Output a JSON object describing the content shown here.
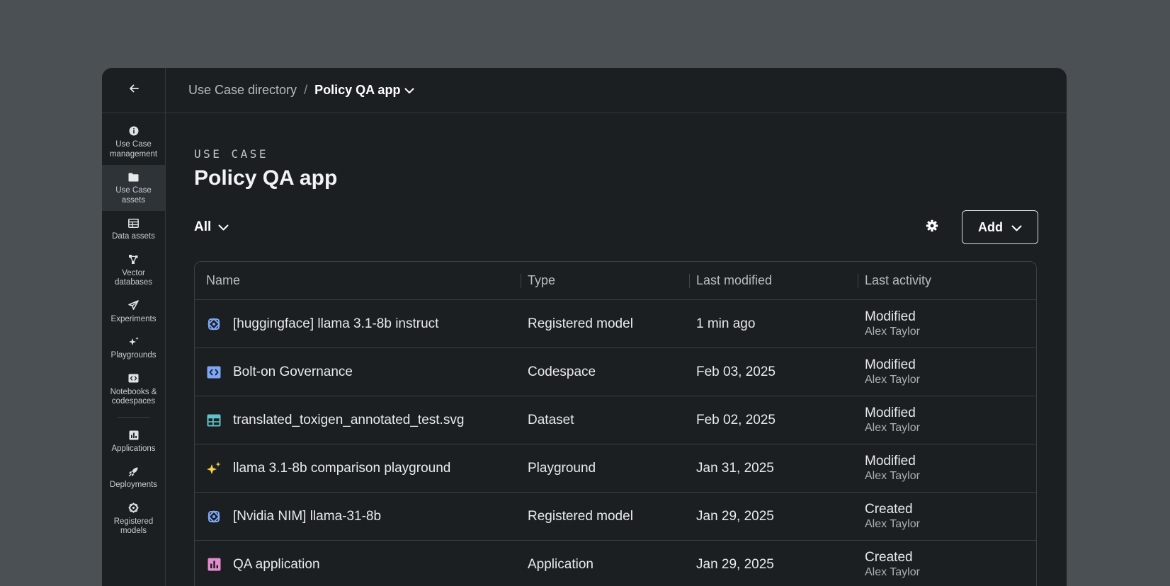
{
  "colors": {
    "backdrop": "#4b5055",
    "window": "#1b1f22",
    "accent_blue": "#7ea6f7",
    "accent_teal": "#5fc3c9",
    "accent_yellow": "#f1d24a",
    "accent_pink": "#e58bd0"
  },
  "sidebar": {
    "back_icon": "arrow-left-icon",
    "items": [
      {
        "label": "Use Case\nmanagement",
        "icon": "info-circle-icon",
        "active": false
      },
      {
        "label": "Use Case\nassets",
        "icon": "folder-icon",
        "active": true
      },
      {
        "label": "Data assets",
        "icon": "table-icon",
        "active": false
      },
      {
        "label": "Vector\ndatabases",
        "icon": "vector-icon",
        "active": false
      },
      {
        "label": "Experiments",
        "icon": "send-icon",
        "active": false
      },
      {
        "label": "Playgrounds",
        "icon": "sparkle-icon",
        "active": false
      },
      {
        "label": "Notebooks &\ncodespaces",
        "icon": "code-icon",
        "active": false
      },
      {
        "label": "Applications",
        "icon": "bar-chart-icon",
        "active": false
      },
      {
        "label": "Deployments",
        "icon": "rocket-icon",
        "active": false
      },
      {
        "label": "Registered\nmodels",
        "icon": "model-icon",
        "active": false
      }
    ]
  },
  "breadcrumb": {
    "parent": "Use Case directory",
    "separator": "/",
    "current": "Policy QA app"
  },
  "header": {
    "eyebrow": "USE CASE",
    "title": "Policy QA app"
  },
  "toolbar": {
    "filter_label": "All",
    "add_label": "Add"
  },
  "table": {
    "columns": [
      "Name",
      "Type",
      "Last modified",
      "Last activity"
    ],
    "rows": [
      {
        "icon": "model-icon",
        "name": "[huggingface] llama 3.1-8b instruct",
        "type": "Registered model",
        "modified": "1 min ago",
        "activity": "Modified",
        "user": "Alex Taylor"
      },
      {
        "icon": "code-icon",
        "name": "Bolt-on Governance",
        "type": "Codespace",
        "modified": "Feb 03, 2025",
        "activity": "Modified",
        "user": "Alex Taylor"
      },
      {
        "icon": "table-icon",
        "name": "translated_toxigen_annotated_test.svg",
        "type": "Dataset",
        "modified": "Feb 02, 2025",
        "activity": "Modified",
        "user": "Alex Taylor"
      },
      {
        "icon": "sparkle-icon",
        "name": "llama 3.1-8b comparison playground",
        "type": "Playground",
        "modified": "Jan 31, 2025",
        "activity": "Modified",
        "user": "Alex Taylor"
      },
      {
        "icon": "model-icon",
        "name": "[Nvidia NIM] llama-31-8b",
        "type": "Registered model",
        "modified": "Jan 29, 2025",
        "activity": "Created",
        "user": "Alex Taylor"
      },
      {
        "icon": "bar-chart-icon",
        "name": "QA application",
        "type": "Application",
        "modified": "Jan 29, 2025",
        "activity": "Created",
        "user": "Alex Taylor"
      }
    ]
  }
}
